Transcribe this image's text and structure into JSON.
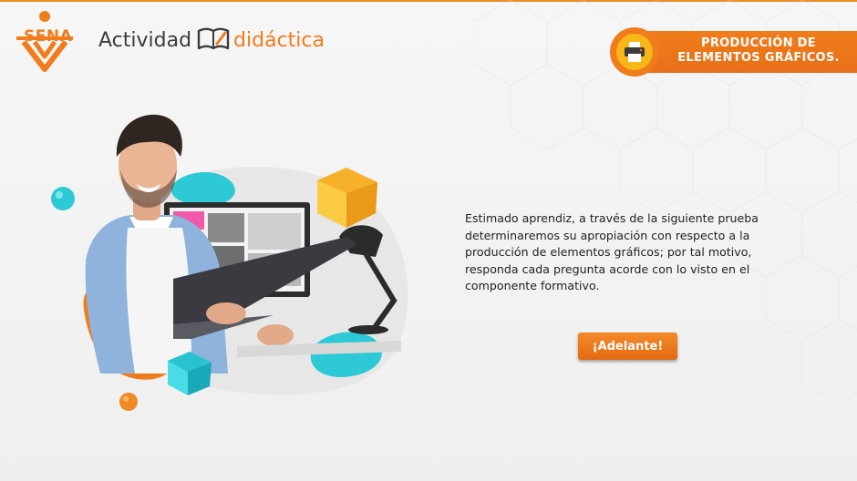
{
  "header": {
    "logo_text": "SENA",
    "activity_word": "Actividad",
    "activity_highlight": "didáctica"
  },
  "badge": {
    "line1": "PRODUCCIÓN DE",
    "line2": "ELEMENTOS GRÁFICOS.",
    "icon": "printer-icon"
  },
  "main": {
    "intro_text": "Estimado aprendiz, a través de la siguiente prueba determinaremos su apropiación con respecto a la producción de elementos gráficos; por tal motivo, responda cada pregunta acorde con lo visto en el componente formativo.",
    "next_button_label": "¡Adelante!"
  },
  "colors": {
    "accent": "#f07c1b",
    "badge_inner": "#f7b719",
    "teal": "#2ec9d6",
    "text": "#222222"
  }
}
